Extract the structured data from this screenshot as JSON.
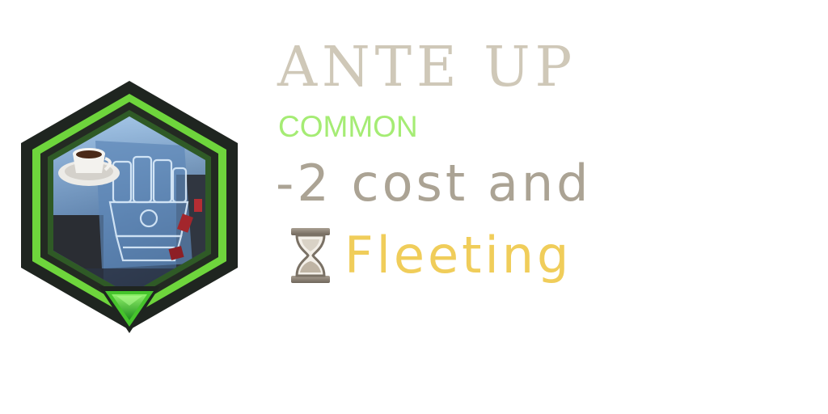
{
  "card": {
    "title": "ANTE UP",
    "rarity": "COMMON",
    "description_line1": "-2 cost and",
    "keyword": "Fleeting"
  },
  "icons": {
    "badge": "hexagon-artwork-badge",
    "rarity_gem": "green-triangle-gem-icon",
    "keyword_icon": "hourglass-icon"
  },
  "colors": {
    "title": "#cfc8b8",
    "rarity": "#a5ec74",
    "description": "#aba394",
    "keyword": "#f0cd5a",
    "frame_outer": "#1f2520",
    "frame_green": "#6ed53c",
    "gem": "#41c82d"
  }
}
